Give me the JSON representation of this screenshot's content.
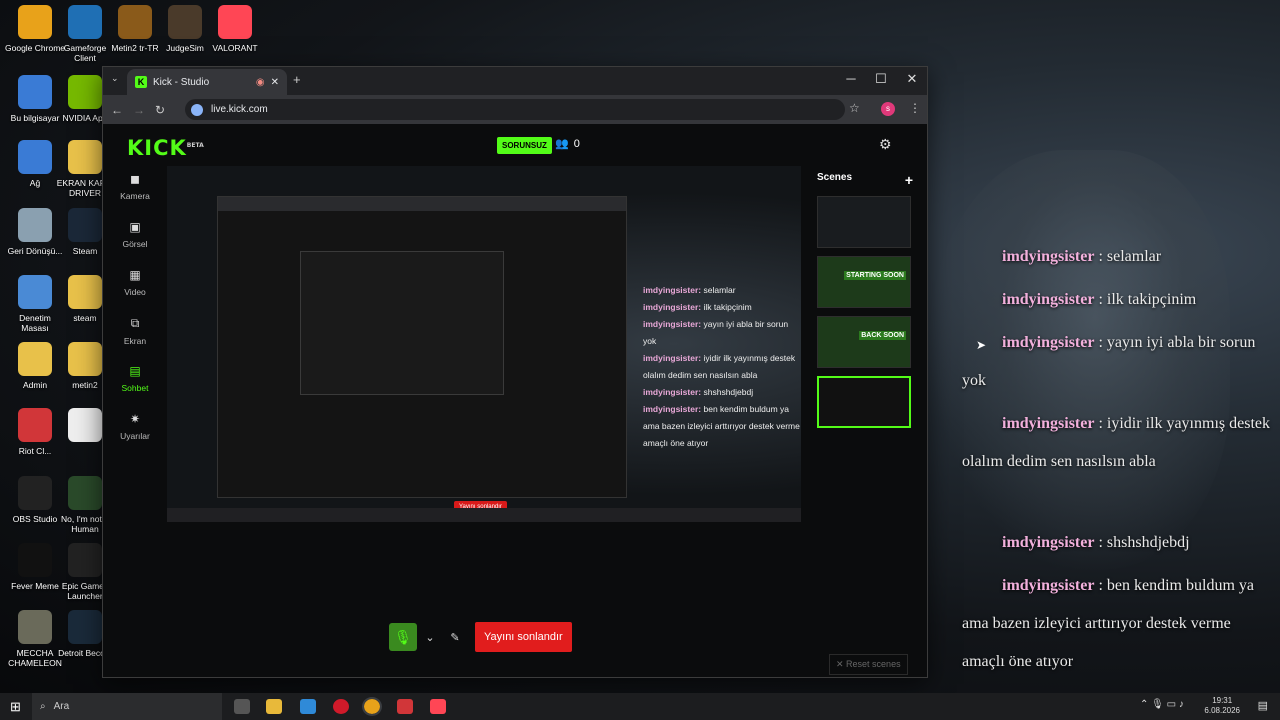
{
  "desktop": {
    "icons": [
      {
        "label": "Google Chrome",
        "color": "#e8a21a"
      },
      {
        "label": "Gameforge Client",
        "color": "#1f6fb4"
      },
      {
        "label": "Metin2 tr-TR",
        "color": "#8a5a1a"
      },
      {
        "label": "JudgeSim",
        "color": "#4a3a2a"
      },
      {
        "label": "VALORANT",
        "color": "#ff4655"
      },
      {
        "label": "Bu bilgisayar",
        "color": "#3a7bd5"
      },
      {
        "label": "NVIDIA App",
        "color": "#76b900"
      },
      {
        "label": "Ağ",
        "color": "#3a7bd5"
      },
      {
        "label": "EKRAN KARTI DRIVER",
        "color": "#e8c14a"
      },
      {
        "label": "Geri Dönüşü...",
        "color": "#8aa0b0"
      },
      {
        "label": "Steam",
        "color": "#1b2838"
      },
      {
        "label": "Denetim Masası",
        "color": "#4a8ad5"
      },
      {
        "label": "steam",
        "color": "#e8c14a"
      },
      {
        "label": "Admin",
        "color": "#e8c14a"
      },
      {
        "label": "metin2",
        "color": "#e8c14a"
      },
      {
        "label": "Riot Cl...",
        "color": "#d13639"
      },
      {
        "label": "",
        "color": "#eeeeee"
      },
      {
        "label": "OBS Studio",
        "color": "#222222"
      },
      {
        "label": "No, I'm not a Human",
        "color": "#2a4a2a"
      },
      {
        "label": "Fever Meme",
        "color": "#111111"
      },
      {
        "label": "Epic Games Launcher",
        "color": "#222222"
      },
      {
        "label": "MECCHA CHAMELEON",
        "color": "#6a6a5a"
      },
      {
        "label": "Detroit Beco...",
        "color": "#1a2a3a"
      }
    ]
  },
  "browser": {
    "tab_title": "Kick - Studio",
    "url": "live.kick.com",
    "new_tab": "+",
    "minimize": "─",
    "maximize": "☐",
    "close": "✕",
    "profile_initial": "s"
  },
  "studio": {
    "logo": "KICK",
    "logo_badge": "BETA",
    "status": "SORUNSUZ",
    "viewers": "0",
    "nav": [
      {
        "label": "Kamera",
        "icon": "camera-icon",
        "glyph": "◼"
      },
      {
        "label": "Görsel",
        "icon": "image-icon",
        "glyph": "▣"
      },
      {
        "label": "Video",
        "icon": "film-icon",
        "glyph": "▦"
      },
      {
        "label": "Ekran",
        "icon": "screen-share-icon",
        "glyph": "⧉"
      },
      {
        "label": "Sohbet",
        "icon": "chat-icon",
        "glyph": "▤"
      },
      {
        "label": "Uyarılar",
        "icon": "alert-icon",
        "glyph": "✷"
      }
    ],
    "preview_chat": [
      {
        "user": "imdyingsister:",
        "text": "selamlar"
      },
      {
        "user": "imdyingsister:",
        "text": "ilk takipçinim"
      },
      {
        "user": "imdyingsister:",
        "text": "yayın iyi abla bir sorun yok"
      },
      {
        "user": "imdyingsister:",
        "text": "iyidir ilk yayınmış destek olalım dedim sen nasılsın abla"
      },
      {
        "user": "imdyingsister:",
        "text": "shshshdjebdj"
      },
      {
        "user": "imdyingsister:",
        "text": "ben kendim buldum ya ama bazen izleyici arttırıyor destek verme amaçlı öne atıyor"
      }
    ],
    "preview_end_label": "Yayını sonlandır",
    "end_stream": "Yayını sonlandır",
    "scenes_title": "Scenes",
    "add_scene": "+",
    "scene_labels": [
      "",
      "STARTING SOON",
      "BACK SOON",
      ""
    ],
    "reset_scenes": "✕ Reset scenes"
  },
  "overlay_chat": [
    {
      "user": "imdyingsister",
      "text": " : selamlar"
    },
    {
      "user": "imdyingsister",
      "text": " : ilk takipçinim"
    },
    {
      "user": "imdyingsister",
      "text": " : yayın iyi abla bir sorun yok"
    },
    {
      "user": "imdyingsister",
      "text": " : iyidir ilk yayınmış destek olalım dedim sen nasılsın abla"
    },
    {
      "user": "imdyingsister",
      "text": " : shshshdjebdj"
    },
    {
      "user": "imdyingsister",
      "text": " : ben kendim buldum ya ama bazen izleyici arttırıyor destek verme amaçlı öne atıyor"
    }
  ],
  "taskbar": {
    "search": "Ara",
    "time": "19:31",
    "date": "6.08.2026"
  }
}
